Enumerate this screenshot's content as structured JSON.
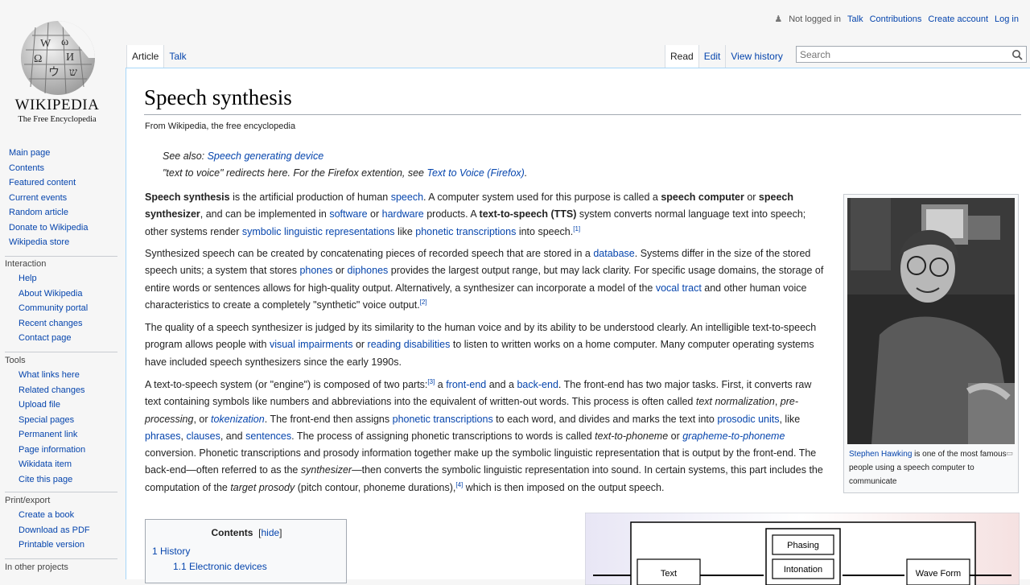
{
  "logo": {
    "title": "WIKIPEDIA",
    "subtitle": "The Free Encyclopedia"
  },
  "personal": {
    "not_logged_in": "Not logged in",
    "talk": "Talk",
    "contributions": "Contributions",
    "create_account": "Create account",
    "log_in": "Log in"
  },
  "tabs": {
    "article": "Article",
    "talk": "Talk",
    "read": "Read",
    "edit": "Edit",
    "view_history": "View history"
  },
  "search": {
    "placeholder": "Search"
  },
  "sidebar": {
    "nav": [
      "Main page",
      "Contents",
      "Featured content",
      "Current events",
      "Random article",
      "Donate to Wikipedia",
      "Wikipedia store"
    ],
    "interaction_heading": "Interaction",
    "interaction": [
      "Help",
      "About Wikipedia",
      "Community portal",
      "Recent changes",
      "Contact page"
    ],
    "tools_heading": "Tools",
    "tools": [
      "What links here",
      "Related changes",
      "Upload file",
      "Special pages",
      "Permanent link",
      "Page information",
      "Wikidata item",
      "Cite this page"
    ],
    "print_heading": "Print/export",
    "print": [
      "Create a book",
      "Download as PDF",
      "Printable version"
    ],
    "other_heading": "In other projects"
  },
  "article": {
    "title": "Speech synthesis",
    "tagline": "From Wikipedia, the free encyclopedia",
    "hatnote1_prefix": "See also: ",
    "hatnote1_link": "Speech generating device",
    "hatnote2_prefix": "\"text to voice\" redirects here. For the Firefox extention, see ",
    "hatnote2_link": "Text to Voice (Firefox)",
    "hatnote2_suffix": "."
  },
  "infobox": {
    "caption_link": "Stephen Hawking",
    "caption_text": " is one of the most famous people using a speech computer to communicate"
  },
  "toc": {
    "title": "Contents",
    "hide": "hide",
    "items": [
      "1 History",
      "1.1 Electronic devices"
    ]
  },
  "diagram": {
    "boxes": [
      "Phasing",
      "Intonation",
      "Text",
      "Wave Form"
    ]
  },
  "colors": {
    "link": "#0645ad",
    "content_border": "#a7d7f9",
    "background": "#f6f6f6"
  }
}
